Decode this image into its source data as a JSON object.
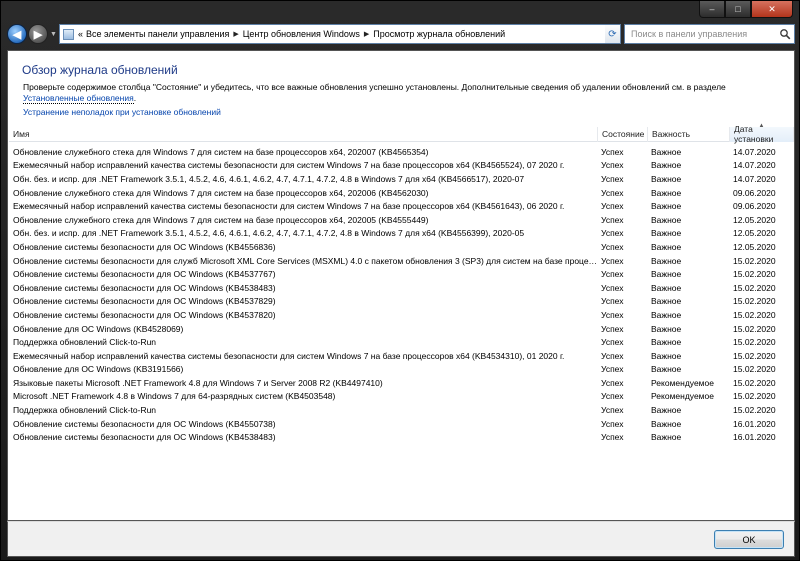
{
  "window": {
    "caption_buttons": {
      "minimize": "–",
      "maximize": "□",
      "close": "✕"
    }
  },
  "navigation": {
    "back_icon": "arrow-left",
    "forward_icon": "arrow-right",
    "address_chevron": "«",
    "breadcrumbs": [
      "Все элементы панели управления",
      "Центр обновления Windows",
      "Просмотр журнала обновлений"
    ],
    "refresh_icon": "refresh",
    "search_placeholder": "Поиск в панели управления"
  },
  "page": {
    "title": "Обзор журнала обновлений",
    "info_text": "Проверьте содержимое столбца \"Состояние\" и убедитесь, что все важные обновления успешно установлены. Дополнительные сведения об удалении обновлений см. в разделе ",
    "info_link": "Установленные обновления",
    "info_end": ".",
    "troubleshoot_link": "Устранение неполадок при установке обновлений"
  },
  "table": {
    "columns": {
      "name": "Имя",
      "status": "Состояние",
      "importance": "Важность",
      "date": "Дата установки"
    },
    "sorted_column": "date",
    "rows": [
      {
        "name": "Обновление служебного стека для Windows 7 для систем на базе процессоров x64, 202007 (KB4565354)",
        "status": "Успех",
        "importance": "Важное",
        "date": "14.07.2020"
      },
      {
        "name": "Ежемесячный набор исправлений качества системы безопасности для систем Windows 7 на базе процессоров x64 (KB4565524), 07 2020 г.",
        "status": "Успех",
        "importance": "Важное",
        "date": "14.07.2020"
      },
      {
        "name": "Обн. без. и испр. для .NET Framework 3.5.1, 4.5.2, 4.6, 4.6.1, 4.6.2, 4.7, 4.7.1, 4.7.2, 4.8 в Windows 7 для x64 (KB4566517), 2020-07",
        "status": "Успех",
        "importance": "Важное",
        "date": "14.07.2020"
      },
      {
        "name": "Обновление служебного стека для Windows 7 для систем на базе процессоров x64, 202006 (KB4562030)",
        "status": "Успех",
        "importance": "Важное",
        "date": "09.06.2020"
      },
      {
        "name": "Ежемесячный набор исправлений качества системы безопасности для систем Windows 7 на базе процессоров x64 (KB4561643), 06 2020 г.",
        "status": "Успех",
        "importance": "Важное",
        "date": "09.06.2020"
      },
      {
        "name": "Обновление служебного стека для Windows 7 для систем на базе процессоров x64, 202005 (KB4555449)",
        "status": "Успех",
        "importance": "Важное",
        "date": "12.05.2020"
      },
      {
        "name": "Обн. без. и испр. для .NET Framework 3.5.1, 4.5.2, 4.6, 4.6.1, 4.6.2, 4.7, 4.7.1, 4.7.2, 4.8 в Windows 7 для x64 (KB4556399), 2020-05",
        "status": "Успех",
        "importance": "Важное",
        "date": "12.05.2020"
      },
      {
        "name": "Обновление системы безопасности для ОС Windows (KB4556836)",
        "status": "Успех",
        "importance": "Важное",
        "date": "12.05.2020"
      },
      {
        "name": "Обновление системы безопасности для служб Microsoft XML Core Services (MSXML) 4.0 с пакетом обновления 3 (SP3) для систем на базе процесс...",
        "status": "Успех",
        "importance": "Важное",
        "date": "15.02.2020"
      },
      {
        "name": "Обновление системы безопасности для ОС Windows (KB4537767)",
        "status": "Успех",
        "importance": "Важное",
        "date": "15.02.2020"
      },
      {
        "name": "Обновление системы безопасности для ОС Windows (KB4538483)",
        "status": "Успех",
        "importance": "Важное",
        "date": "15.02.2020"
      },
      {
        "name": "Обновление системы безопасности для ОС Windows (KB4537829)",
        "status": "Успех",
        "importance": "Важное",
        "date": "15.02.2020"
      },
      {
        "name": "Обновление системы безопасности для ОС Windows (KB4537820)",
        "status": "Успех",
        "importance": "Важное",
        "date": "15.02.2020"
      },
      {
        "name": "Обновление для ОС Windows (KB4528069)",
        "status": "Успех",
        "importance": "Важное",
        "date": "15.02.2020"
      },
      {
        "name": "Поддержка обновлений Click-to-Run",
        "status": "Успех",
        "importance": "Важное",
        "date": "15.02.2020"
      },
      {
        "name": "Ежемесячный набор исправлений качества системы безопасности для систем Windows 7 на базе процессоров x64 (KB4534310), 01 2020 г.",
        "status": "Успех",
        "importance": "Важное",
        "date": "15.02.2020"
      },
      {
        "name": "Обновление для ОС Windows (KB3191566)",
        "status": "Успех",
        "importance": "Важное",
        "date": "15.02.2020"
      },
      {
        "name": "Языковые пакеты Microsoft .NET Framework 4.8 для Windows 7 и Server 2008 R2 (KB4497410)",
        "status": "Успех",
        "importance": "Рекомендуемое",
        "date": "15.02.2020"
      },
      {
        "name": "Microsoft .NET Framework 4.8 в Windows 7 для 64-разрядных систем (KB4503548)",
        "status": "Успех",
        "importance": "Рекомендуемое",
        "date": "15.02.2020"
      },
      {
        "name": "Поддержка обновлений Click-to-Run",
        "status": "Успех",
        "importance": "Важное",
        "date": "15.02.2020"
      },
      {
        "name": "Обновление системы безопасности для ОС Windows (KB4550738)",
        "status": "Успех",
        "importance": "Важное",
        "date": "16.01.2020"
      },
      {
        "name": "Обновление системы безопасности для ОС Windows (KB4538483)",
        "status": "Успех",
        "importance": "Важное",
        "date": "16.01.2020"
      }
    ]
  },
  "footer": {
    "ok_label": "OK"
  }
}
